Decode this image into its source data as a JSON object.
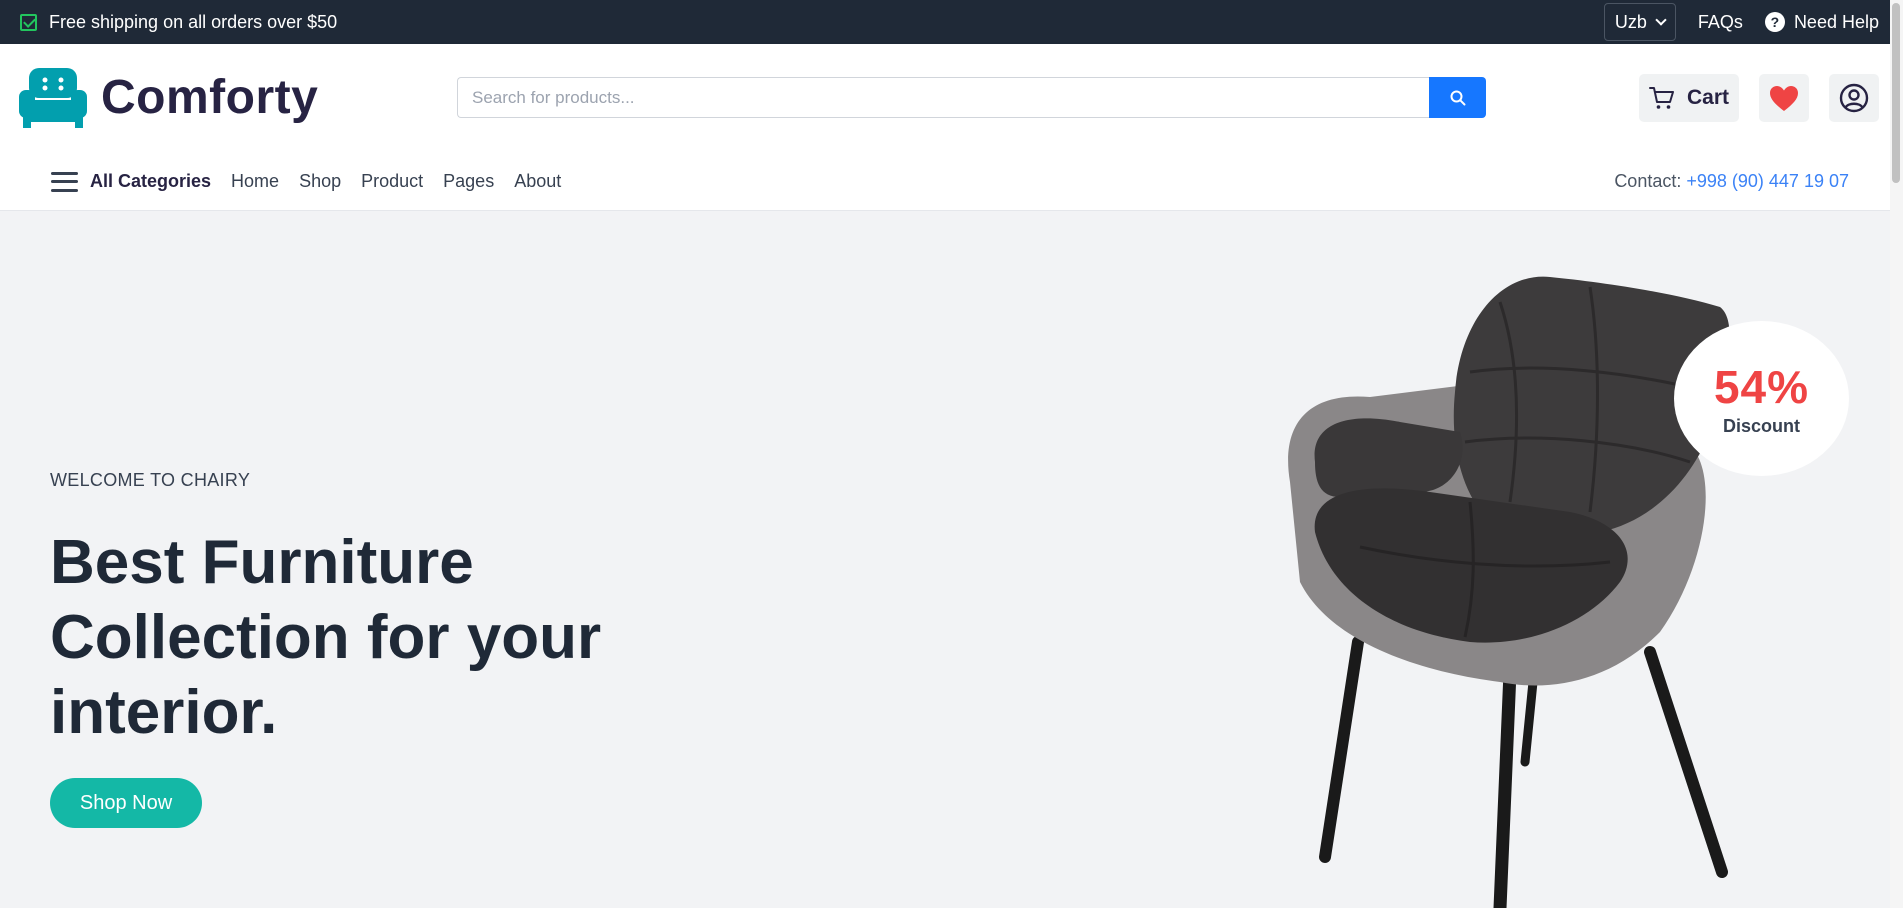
{
  "topbar": {
    "shipping_text": "Free shipping on all orders over $50",
    "language": "Uzb",
    "faqs": "FAQs",
    "help": "Need Help"
  },
  "header": {
    "brand": "Comforty",
    "search_placeholder": "Search for products...",
    "cart_label": "Cart"
  },
  "nav": {
    "all_categories": "All Categories",
    "links": [
      "Home",
      "Shop",
      "Product",
      "Pages",
      "About"
    ],
    "contact_label": "Contact:",
    "contact_phone": "+998 (90) 447 19 07"
  },
  "hero": {
    "subtitle": "WELCOME TO CHAIRY",
    "title": "Best Furniture Collection for your interior.",
    "button": "Shop Now",
    "discount_value": "54%",
    "discount_label": "Discount"
  },
  "colors": {
    "topbar_bg": "#1f2937",
    "accent_teal": "#14b8a6",
    "search_blue": "#1677ff",
    "discount_red": "#ef4444",
    "heart_red": "#ef4444",
    "link_blue": "#3b82f6"
  },
  "icons": [
    "check-icon",
    "chevron-down-icon",
    "help-icon",
    "sofa-logo-icon",
    "search-icon",
    "cart-icon",
    "heart-icon",
    "user-icon",
    "hamburger-icon"
  ]
}
